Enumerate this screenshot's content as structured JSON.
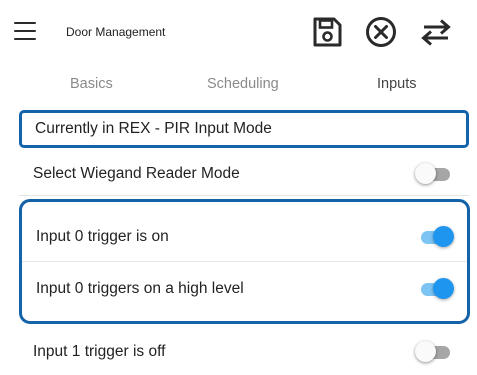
{
  "appbar": {
    "title": "Door Management",
    "menu_icon": "hamburger-menu-icon",
    "save_icon": "floppy-disk-save-icon",
    "cancel_icon": "circle-x-cancel-icon",
    "swap_icon": "swap-arrows-icon"
  },
  "tabs": [
    {
      "label": "Basics",
      "active": false
    },
    {
      "label": "Scheduling",
      "active": false
    },
    {
      "label": "Inputs",
      "active": true
    }
  ],
  "mode_banner": {
    "text": "Currently in REX - PIR Input Mode"
  },
  "settings": [
    {
      "label": "Select Wiegand Reader Mode",
      "enabled": false
    },
    {
      "label": "Input 0 trigger is on",
      "enabled": true
    },
    {
      "label": "Input 0 triggers on a high level",
      "enabled": true
    },
    {
      "label": "Input 1 trigger is off",
      "enabled": false
    }
  ],
  "colors": {
    "highlight_border": "#1463a8",
    "toggle_on_thumb": "#1e96f0",
    "toggle_on_track": "#7cc4f4",
    "toggle_off_track": "#a6a6a6"
  }
}
